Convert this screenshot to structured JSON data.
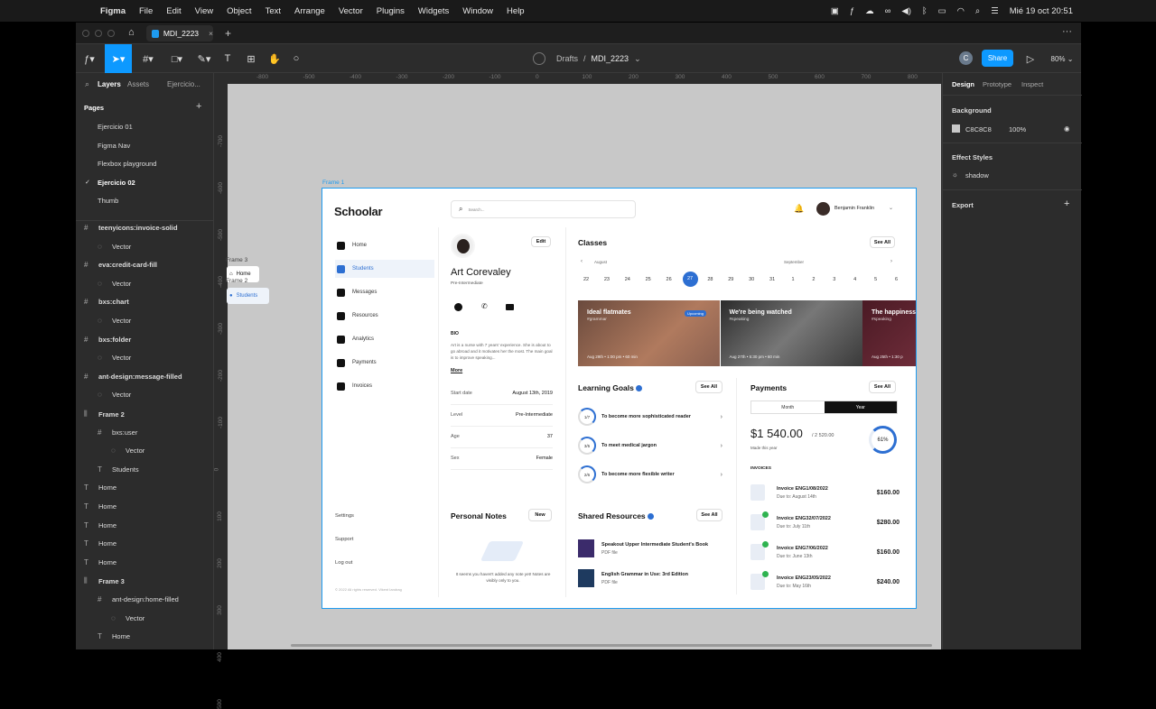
{
  "menubar": {
    "app": "Figma",
    "items": [
      "File",
      "Edit",
      "View",
      "Object",
      "Text",
      "Arrange",
      "Vector",
      "Plugins",
      "Widgets",
      "Window",
      "Help"
    ],
    "clock": "Mié 19 oct  20:51"
  },
  "tabbar": {
    "file_tab": "MDI_2223"
  },
  "toolbar": {
    "breadcrumb_parent": "Drafts",
    "breadcrumb_sep": "/",
    "breadcrumb_file": "MDI_2223",
    "share": "Share",
    "zoom": "80%",
    "user_initial": "C"
  },
  "left_panel": {
    "tabs": [
      "Layers",
      "Assets",
      "Ejercicio..."
    ],
    "pages_title": "Pages",
    "pages": [
      "Ejercicio 01",
      "Figma Nav",
      "Flexbox playground",
      "Ejercicio 02",
      "Thumb"
    ],
    "layers": [
      {
        "label": "teenyicons:invoice-solid",
        "bold": true,
        "indent": 0
      },
      {
        "label": "Vector",
        "bold": false,
        "indent": 1
      },
      {
        "label": "eva:credit-card-fill",
        "bold": true,
        "indent": 0
      },
      {
        "label": "Vector",
        "bold": false,
        "indent": 1
      },
      {
        "label": "bxs:chart",
        "bold": true,
        "indent": 0
      },
      {
        "label": "Vector",
        "bold": false,
        "indent": 1
      },
      {
        "label": "bxs:folder",
        "bold": true,
        "indent": 0
      },
      {
        "label": "Vector",
        "bold": false,
        "indent": 1
      },
      {
        "label": "ant-design:message-filled",
        "bold": true,
        "indent": 0
      },
      {
        "label": "Vector",
        "bold": false,
        "indent": 1
      },
      {
        "label": "Frame 2",
        "bold": true,
        "indent": 0
      },
      {
        "label": "bxs:user",
        "bold": false,
        "indent": 1
      },
      {
        "label": "Vector",
        "bold": false,
        "indent": 2
      },
      {
        "label": "Students",
        "bold": false,
        "indent": 1
      },
      {
        "label": "Home",
        "bold": false,
        "indent": 0
      },
      {
        "label": "Home",
        "bold": false,
        "indent": 0
      },
      {
        "label": "Home",
        "bold": false,
        "indent": 0
      },
      {
        "label": "Home",
        "bold": false,
        "indent": 0
      },
      {
        "label": "Home",
        "bold": false,
        "indent": 0
      },
      {
        "label": "Frame 3",
        "bold": true,
        "indent": 0
      },
      {
        "label": "ant-design:home-filled",
        "bold": false,
        "indent": 1
      },
      {
        "label": "Vector",
        "bold": false,
        "indent": 2
      },
      {
        "label": "Home",
        "bold": false,
        "indent": 1
      }
    ]
  },
  "right_panel": {
    "tabs": [
      "Design",
      "Prototype",
      "Inspect"
    ],
    "background_title": "Background",
    "bg_hex": "C8C8C8",
    "bg_opacity": "100%",
    "effect_title": "Effect Styles",
    "effect": "shadow",
    "export_title": "Export"
  },
  "rulers": {
    "h": [
      "-800",
      "-500",
      "-400",
      "-300",
      "-200",
      "-100",
      "0",
      "100",
      "200",
      "300",
      "400",
      "500",
      "600",
      "700",
      "800"
    ],
    "v": [
      "-700",
      "-600",
      "-500",
      "-400",
      "-300",
      "-200",
      "-100",
      "0",
      "100",
      "200",
      "300",
      "400",
      "500"
    ]
  },
  "canvas": {
    "frame_label": "Frame 1",
    "frame3_label": "Frame 3",
    "frame2_label": "Frame 2",
    "mini_home": "Home",
    "mini_students": "Students"
  },
  "app": {
    "logo": "Schoolar",
    "search_placeholder": "Search...",
    "user_name": "Benjamin Franklin",
    "nav": [
      "Home",
      "Students",
      "Messages",
      "Resources",
      "Analytics",
      "Payments",
      "Invoices"
    ],
    "bottom_nav": [
      "Settings",
      "Support",
      "Log out"
    ],
    "footer": "© 2022 All rights reserved. Vikent Iandrag",
    "profile": {
      "name": "Art Corevaley",
      "level_sub": "Pre-Intermediate",
      "edit": "Edit",
      "bio_title": "BIO",
      "bio": "Art is a nurse with 7 years' experience. She is about to go abroad and it motivates her the most. The main goal is to improve speaking...",
      "more": "More",
      "rows": [
        [
          "Start date",
          "August 13th, 2019"
        ],
        [
          "Level",
          "Pre-Intermediate"
        ],
        [
          "Age",
          "37"
        ],
        [
          "Sex",
          "Female"
        ]
      ]
    },
    "notes": {
      "title": "Personal Notes",
      "new": "New",
      "empty": "It seems you haven't added any note yet! Notes are visibly only to you."
    },
    "classes": {
      "title": "Classes",
      "see_all": "See All",
      "month1": "August",
      "month2": "September",
      "dates": [
        "22",
        "23",
        "24",
        "25",
        "26",
        "27",
        "28",
        "29",
        "30",
        "31",
        "1",
        "2",
        "3",
        "4",
        "5",
        "6"
      ],
      "selected": "27",
      "cards": [
        {
          "title": "Ideal flatmates",
          "tag": "#grammar",
          "meta": "Aug 29th  •  1:00 pm  •  60 min",
          "badge": "Upcoming"
        },
        {
          "title": "We're being watched",
          "tag": "#speaking",
          "meta": "Aug 27th  •  5:30 pm  •  60 min",
          "badge": ""
        },
        {
          "title": "The happiness",
          "tag": "#speaking",
          "meta": "Aug 25th  •  1:30 p",
          "badge": ""
        }
      ]
    },
    "goals": {
      "title": "Learning Goals",
      "see_all": "See All",
      "items": [
        [
          "1/7",
          "To become more sophisticated reader"
        ],
        [
          "3/5",
          "To meet medical jargon"
        ],
        [
          "2/6",
          "To become more flexible writer"
        ]
      ]
    },
    "resources": {
      "title": "Shared Resources",
      "see_all": "See All",
      "items": [
        [
          "Speakout Upper Intermediate Student's Book",
          "PDF file"
        ],
        [
          "English Grammar in Use: 3rd Edition",
          "PDF file"
        ]
      ]
    },
    "payments": {
      "title": "Payments",
      "see_all": "See All",
      "toggle": [
        "Month",
        "Year"
      ],
      "amount": "$1 540.00",
      "total": "/ 2 520.00",
      "sub": "Made this year",
      "percent": "61%",
      "invoices_title": "INVOICES",
      "invoices": [
        [
          "Invoice ENG1/08/2022",
          "Due to: August 14th",
          "$160.00"
        ],
        [
          "Invoice ENG32/07/2022",
          "Due to: July 11th",
          "$280.00"
        ],
        [
          "Invoice ENG7/06/2022",
          "Due to: June 13th",
          "$160.00"
        ],
        [
          "Invoice ENG23/05/2022",
          "Due to: May 16th",
          "$240.00"
        ]
      ]
    }
  }
}
